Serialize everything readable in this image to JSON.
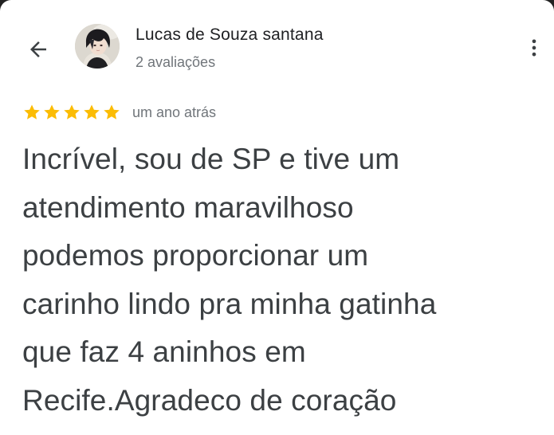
{
  "header": {
    "back_icon": "arrow-back-icon",
    "more_icon": "more-vert-icon"
  },
  "author": {
    "name": "Lucas de Souza santana",
    "meta": "2 avaliações",
    "avatar_icon": "profile-photo"
  },
  "review": {
    "rating": 5,
    "max_rating": 5,
    "date": "um ano atrás",
    "text_lines": [
      "Incrível, sou de SP e tive um",
      "atendimento maravilhoso",
      "podemos proporcionar um",
      "carinho lindo pra minha gatinha",
      "que faz 4 aninhos em",
      "Recife.Agradeco de coração"
    ]
  },
  "colors": {
    "star": "#fbbc04",
    "text_primary": "#202124",
    "text_body": "#3c4043",
    "text_secondary": "#70757a",
    "background": "#ffffff"
  }
}
